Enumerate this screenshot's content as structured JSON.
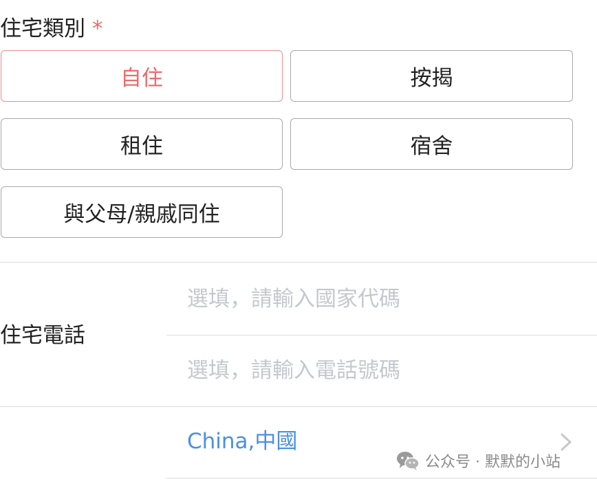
{
  "residence": {
    "label": "住宅類別",
    "required_mark": "*",
    "options": [
      {
        "label": "自住",
        "selected": true
      },
      {
        "label": "按揭",
        "selected": false
      },
      {
        "label": "租住",
        "selected": false
      },
      {
        "label": "宿舍",
        "selected": false
      },
      {
        "label": "與父母/親戚同住",
        "selected": false
      }
    ]
  },
  "home_phone": {
    "label": "住宅電話",
    "country_code_placeholder": "選填，請輸入國家代碼",
    "country_code_value": "",
    "number_placeholder": "選填，請輸入電話號碼",
    "number_value": ""
  },
  "country": {
    "value": "China,中國",
    "icon": "chevron-right-icon"
  },
  "watermark": {
    "icon": "wechat-icon",
    "text": "公众号 · 默默的小站"
  },
  "colors": {
    "accent_red": "#f06a6a",
    "link_blue": "#4a8fe6",
    "placeholder_gray": "#c4c8cd",
    "border_gray": "#a9a9a9"
  }
}
